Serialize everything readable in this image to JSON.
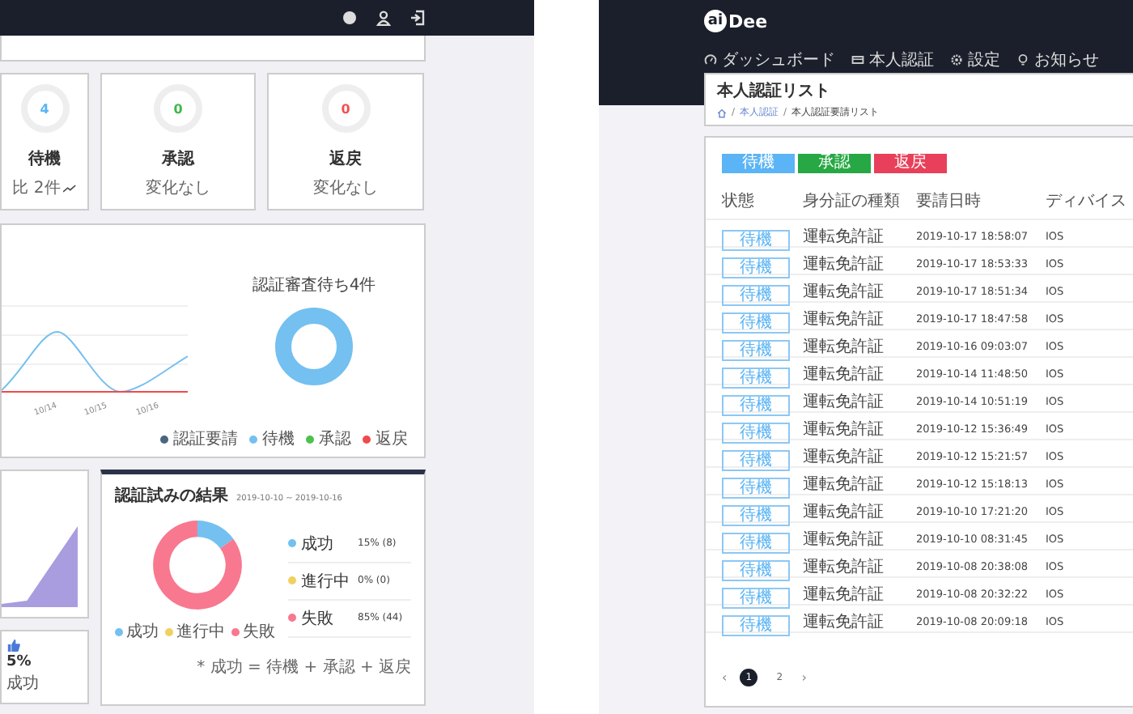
{
  "left": {
    "stats": [
      {
        "value": "4",
        "label": "待機",
        "note": "比 2件",
        "color": "#5ab4f5",
        "trend_up": true
      },
      {
        "value": "0",
        "label": "承認",
        "note": "変化なし",
        "color": "#3cb84a",
        "trend_up": false
      },
      {
        "value": "0",
        "label": "返戻",
        "note": "変化なし",
        "color": "#f05050",
        "trend_up": false
      }
    ],
    "status_chart": {
      "title": "認証審査待ち4件",
      "x_labels": [
        "10/14",
        "10/15",
        "10/16"
      ],
      "legend": [
        {
          "label": "認証要請",
          "color": "#4a6580"
        },
        {
          "label": "待機",
          "color": "#74c0f0"
        },
        {
          "label": "承認",
          "color": "#4cc24c"
        },
        {
          "label": "返戻",
          "color": "#f04a4a"
        }
      ]
    },
    "success": {
      "value": "5%",
      "label": "成功"
    },
    "attempts": {
      "title": "認証試みの結果",
      "period": "2019-10-10 ~ 2019-10-16",
      "chart_data": {
        "type": "donut",
        "categories": [
          "成功",
          "進行中",
          "失敗"
        ],
        "values": [
          15,
          0,
          85
        ],
        "legend": "bottom"
      },
      "legend": [
        {
          "color": "#74c0f0"
        },
        {
          "color": "#f2d060"
        },
        {
          "color": "#f87890"
        }
      ],
      "rows": [
        {
          "label": "成功",
          "value": "15% (8)",
          "color": "#74c0f0"
        },
        {
          "label": "進行中",
          "value": "0% (0)",
          "color": "#f2d060"
        },
        {
          "label": "失敗",
          "value": "85% (44)",
          "color": "#f87890"
        }
      ],
      "note": "* 成功 = 待機 + 承認 + 返戻"
    }
  },
  "right": {
    "brand": {
      "mark": "ai",
      "name": "Dee"
    },
    "nav": [
      "ダッシュボード",
      "本人認証",
      "設定",
      "お知らせ"
    ],
    "page": {
      "title": "本人認証リスト",
      "breadcrumb": [
        "本人認証",
        "本人認証要請リスト"
      ],
      "separator": "/"
    },
    "filters": [
      {
        "label": "待機",
        "color": "#5ab4f5"
      },
      {
        "label": "承認",
        "color": "#27a844"
      },
      {
        "label": "返戻",
        "color": "#e8405a"
      }
    ],
    "table": {
      "columns": [
        "状態",
        "身分証の種類",
        "要請日時",
        "ディバイス"
      ],
      "rows": [
        {
          "status": "待機",
          "id_type": "運転免許証",
          "requested_at": "2019-10-17 18:58:07",
          "device": "IOS"
        },
        {
          "status": "待機",
          "id_type": "運転免許証",
          "requested_at": "2019-10-17 18:53:33",
          "device": "IOS"
        },
        {
          "status": "待機",
          "id_type": "運転免許証",
          "requested_at": "2019-10-17 18:51:34",
          "device": "IOS"
        },
        {
          "status": "待機",
          "id_type": "運転免許証",
          "requested_at": "2019-10-17 18:47:58",
          "device": "IOS"
        },
        {
          "status": "待機",
          "id_type": "運転免許証",
          "requested_at": "2019-10-16 09:03:07",
          "device": "IOS"
        },
        {
          "status": "待機",
          "id_type": "運転免許証",
          "requested_at": "2019-10-14 11:48:50",
          "device": "IOS"
        },
        {
          "status": "待機",
          "id_type": "運転免許証",
          "requested_at": "2019-10-14 10:51:19",
          "device": "IOS"
        },
        {
          "status": "待機",
          "id_type": "運転免許証",
          "requested_at": "2019-10-12 15:36:49",
          "device": "IOS"
        },
        {
          "status": "待機",
          "id_type": "運転免許証",
          "requested_at": "2019-10-12 15:21:57",
          "device": "IOS"
        },
        {
          "status": "待機",
          "id_type": "運転免許証",
          "requested_at": "2019-10-12 15:18:13",
          "device": "IOS"
        },
        {
          "status": "待機",
          "id_type": "運転免許証",
          "requested_at": "2019-10-10 17:21:20",
          "device": "IOS"
        },
        {
          "status": "待機",
          "id_type": "運転免許証",
          "requested_at": "2019-10-10 08:31:45",
          "device": "IOS"
        },
        {
          "status": "待機",
          "id_type": "運転免許証",
          "requested_at": "2019-10-08 20:38:08",
          "device": "IOS"
        },
        {
          "status": "待機",
          "id_type": "運転免許証",
          "requested_at": "2019-10-08 20:32:22",
          "device": "IOS"
        },
        {
          "status": "待機",
          "id_type": "運転免許証",
          "requested_at": "2019-10-08 20:09:18",
          "device": "IOS"
        }
      ]
    },
    "pagination": {
      "prev": "‹",
      "pages": [
        {
          "label": "1",
          "selected": true
        },
        {
          "label": "2",
          "selected": false
        }
      ],
      "next": "›"
    }
  }
}
